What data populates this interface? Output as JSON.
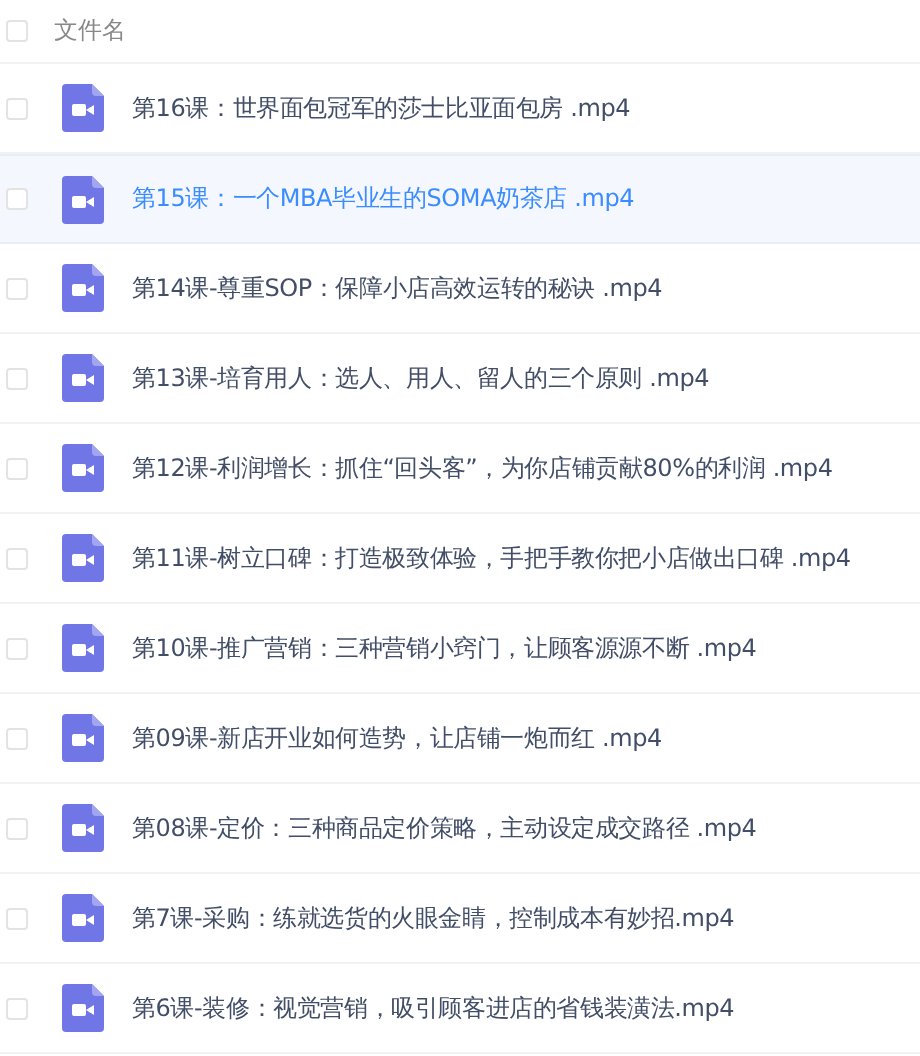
{
  "header": {
    "label": "文件名",
    "checked": false
  },
  "files": [
    {
      "name": "第16课：世界面包冠军的莎士比亚面包房 .mp4",
      "selected": false,
      "checked": false
    },
    {
      "name": "第15课：一个MBA毕业生的SOMA奶茶店 .mp4",
      "selected": true,
      "checked": false
    },
    {
      "name": "第14课-尊重SOP：保障小店高效运转的秘诀 .mp4",
      "selected": false,
      "checked": false
    },
    {
      "name": "第13课-培育用人：选人、用人、留人的三个原则 .mp4",
      "selected": false,
      "checked": false
    },
    {
      "name": "第12课-利润增长：抓住“回头客”，为你店铺贡献80%的利润 .mp4",
      "selected": false,
      "checked": false
    },
    {
      "name": "第11课-树立口碑：打造极致体验，手把手教你把小店做出口碑 .mp4",
      "selected": false,
      "checked": false
    },
    {
      "name": "第10课-推广营销：三种营销小窍门，让顾客源源不断 .mp4",
      "selected": false,
      "checked": false
    },
    {
      "name": "第09课-新店开业如何造势，让店铺一炮而红 .mp4",
      "selected": false,
      "checked": false
    },
    {
      "name": "第08课-定价：三种商品定价策略，主动设定成交路径 .mp4",
      "selected": false,
      "checked": false
    },
    {
      "name": "第7课-采购：练就选货的火眼金睛，控制成本有妙招.mp4",
      "selected": false,
      "checked": false
    },
    {
      "name": "第6课-装修：视觉营销，吸引顾客进店的省钱装潢法.mp4",
      "selected": false,
      "checked": false
    }
  ]
}
